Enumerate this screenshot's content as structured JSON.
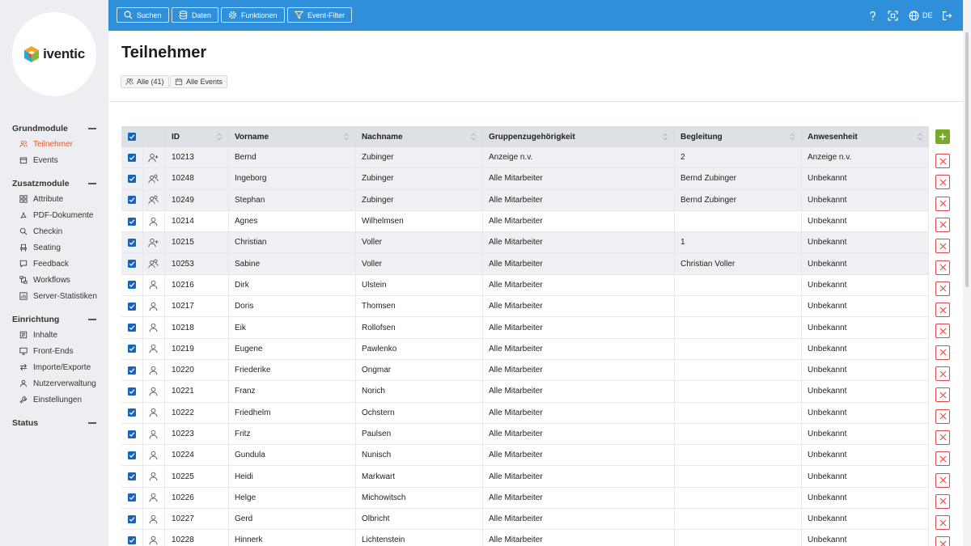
{
  "app": {
    "logo_text": "iventic"
  },
  "topbar": {
    "buttons": [
      "Suchen",
      "Daten",
      "Funktionen",
      "Event-Filter"
    ],
    "lang": "DE"
  },
  "sidebar": {
    "sections": [
      {
        "title": "Grundmodule",
        "items": [
          "Teilnehmer",
          "Events"
        ]
      },
      {
        "title": "Zusatzmodule",
        "items": [
          "Attribute",
          "PDF-Dokumente",
          "Checkin",
          "Seating",
          "Feedback",
          "Workflows",
          "Server-Statistiken"
        ]
      },
      {
        "title": "Einrichtung",
        "items": [
          "Inhalte",
          "Front-Ends",
          "Importe/Exporte",
          "Nutzerverwaltung",
          "Einstellungen"
        ]
      },
      {
        "title": "Status",
        "items": []
      }
    ],
    "active_item": "Teilnehmer"
  },
  "page": {
    "title": "Teilnehmer",
    "chips": [
      "Alle (41)",
      "Alle Events"
    ]
  },
  "table": {
    "columns": [
      "ID",
      "Vorname",
      "Nachname",
      "Gruppenzugehörigkeit",
      "Begleitung",
      "Anwesenheit"
    ],
    "rows": [
      {
        "icon": "user-plus",
        "id": "10213",
        "vorname": "Bernd",
        "nachname": "Zubinger",
        "gruppe": "Anzeige n.v.",
        "begleitung": "2",
        "anwesenheit": "Anzeige n.v.",
        "hl": true
      },
      {
        "icon": "users",
        "id": "10248",
        "vorname": "Ingeborg",
        "nachname": "Zubinger",
        "gruppe": "Alle Mitarbeiter",
        "begleitung": "Bernd Zubinger",
        "anwesenheit": "Unbekannt",
        "hl": true
      },
      {
        "icon": "users",
        "id": "10249",
        "vorname": "Stephan",
        "nachname": "Zubinger",
        "gruppe": "Alle Mitarbeiter",
        "begleitung": "Bernd Zubinger",
        "anwesenheit": "Unbekannt",
        "hl": true
      },
      {
        "icon": "user",
        "id": "10214",
        "vorname": "Agnes",
        "nachname": "Wilhelmsen",
        "gruppe": "Alle Mitarbeiter",
        "begleitung": "",
        "anwesenheit": "Unbekannt",
        "hl": false
      },
      {
        "icon": "user-plus",
        "id": "10215",
        "vorname": "Christian",
        "nachname": "Voller",
        "gruppe": "Alle Mitarbeiter",
        "begleitung": "1",
        "anwesenheit": "Unbekannt",
        "hl": true
      },
      {
        "icon": "users",
        "id": "10253",
        "vorname": "Sabine",
        "nachname": "Voller",
        "gruppe": "Alle Mitarbeiter",
        "begleitung": "Christian Voller",
        "anwesenheit": "Unbekannt",
        "hl": true
      },
      {
        "icon": "user",
        "id": "10216",
        "vorname": "Dirk",
        "nachname": "Ulstein",
        "gruppe": "Alle Mitarbeiter",
        "begleitung": "",
        "anwesenheit": "Unbekannt",
        "hl": false
      },
      {
        "icon": "user",
        "id": "10217",
        "vorname": "Doris",
        "nachname": "Thomsen",
        "gruppe": "Alle Mitarbeiter",
        "begleitung": "",
        "anwesenheit": "Unbekannt",
        "hl": false
      },
      {
        "icon": "user",
        "id": "10218",
        "vorname": "Eik",
        "nachname": "Rollofsen",
        "gruppe": "Alle Mitarbeiter",
        "begleitung": "",
        "anwesenheit": "Unbekannt",
        "hl": false
      },
      {
        "icon": "user",
        "id": "10219",
        "vorname": "Eugene",
        "nachname": "Pawlenko",
        "gruppe": "Alle Mitarbeiter",
        "begleitung": "",
        "anwesenheit": "Unbekannt",
        "hl": false
      },
      {
        "icon": "user",
        "id": "10220",
        "vorname": "Friederike",
        "nachname": "Ongmar",
        "gruppe": "Alle Mitarbeiter",
        "begleitung": "",
        "anwesenheit": "Unbekannt",
        "hl": false
      },
      {
        "icon": "user",
        "id": "10221",
        "vorname": "Franz",
        "nachname": "Norich",
        "gruppe": "Alle Mitarbeiter",
        "begleitung": "",
        "anwesenheit": "Unbekannt",
        "hl": false
      },
      {
        "icon": "user",
        "id": "10222",
        "vorname": "Friedhelm",
        "nachname": "Ochstern",
        "gruppe": "Alle Mitarbeiter",
        "begleitung": "",
        "anwesenheit": "Unbekannt",
        "hl": false
      },
      {
        "icon": "user",
        "id": "10223",
        "vorname": "Fritz",
        "nachname": "Paulsen",
        "gruppe": "Alle Mitarbeiter",
        "begleitung": "",
        "anwesenheit": "Unbekannt",
        "hl": false
      },
      {
        "icon": "user",
        "id": "10224",
        "vorname": "Gundula",
        "nachname": "Nunisch",
        "gruppe": "Alle Mitarbeiter",
        "begleitung": "",
        "anwesenheit": "Unbekannt",
        "hl": false
      },
      {
        "icon": "user",
        "id": "10225",
        "vorname": "Heidi",
        "nachname": "Markwart",
        "gruppe": "Alle Mitarbeiter",
        "begleitung": "",
        "anwesenheit": "Unbekannt",
        "hl": false
      },
      {
        "icon": "user",
        "id": "10226",
        "vorname": "Helge",
        "nachname": "Michowitsch",
        "gruppe": "Alle Mitarbeiter",
        "begleitung": "",
        "anwesenheit": "Unbekannt",
        "hl": false
      },
      {
        "icon": "user",
        "id": "10227",
        "vorname": "Gerd",
        "nachname": "Olbricht",
        "gruppe": "Alle Mitarbeiter",
        "begleitung": "",
        "anwesenheit": "Unbekannt",
        "hl": false
      },
      {
        "icon": "user",
        "id": "10228",
        "vorname": "Hinnerk",
        "nachname": "Lichtenstein",
        "gruppe": "Alle Mitarbeiter",
        "begleitung": "",
        "anwesenheit": "Unbekannt",
        "hl": false
      }
    ]
  },
  "colors": {
    "topbar": "#2f8fd8",
    "accent": "#e65a1e",
    "checkbox": "#1565c0",
    "add": "#7aa82a",
    "delete": "#e04848"
  }
}
